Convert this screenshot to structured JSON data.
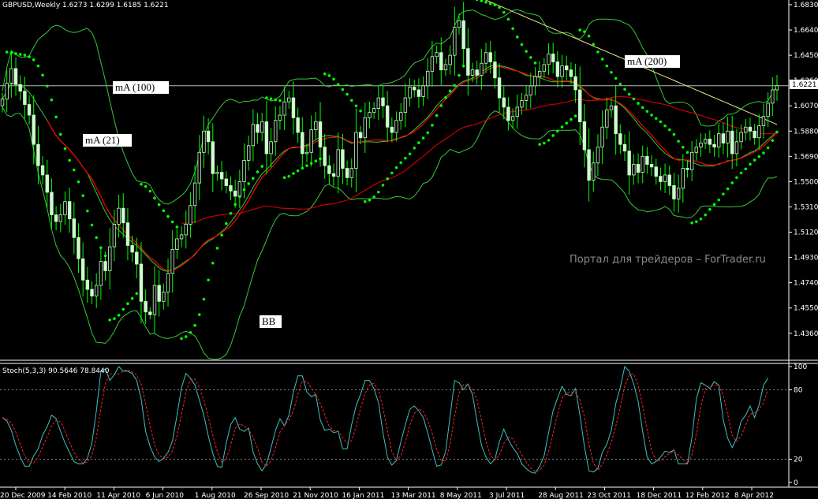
{
  "colors": {
    "background": "#000000",
    "grid": "#ffffff",
    "candle": "#ccffcc",
    "wick": "#00ff00",
    "sar": "#00ff00",
    "ma21": "#ff0000",
    "ma100": "#c80000",
    "ma200": "#f0e68c",
    "bands": "#37c837",
    "stoch_main": "#40c0c0",
    "stoch_signal": "#ff2020",
    "axis_text": "#ffffff"
  },
  "price_pane": {
    "header": "GBPUSD,Weekly  1.6273 1.6299 1.6185 1.6221",
    "y_ticks": [
      "1.6830",
      "1.6640",
      "1.6450",
      "1.6260",
      "1.6070",
      "1.5880",
      "1.5690",
      "1.5500",
      "1.5310",
      "1.5120",
      "1.4930",
      "1.4740",
      "1.4550",
      "1.4360"
    ],
    "current_price_label": "1.6221",
    "annotations": {
      "ma100": "mA (100)",
      "ma21": "mA (21)",
      "ma200": "mA (200)",
      "bb": "BB"
    },
    "watermark": "Портал для трейдеров – ForTrader.ru"
  },
  "stoch_pane": {
    "header": "Stoch(5,3,3) 90.5646 78.8440",
    "y_ticks": [
      "100",
      "80",
      "20",
      "0"
    ]
  },
  "x_ticks": [
    "20 Dec 2009",
    "14 Feb 2010",
    "11 Apr 2010",
    "6 Jun 2010",
    "1 Aug 2010",
    "26 Sep 2010",
    "21 Nov 2010",
    "16 Jan 2011",
    "13 Mar 2011",
    "8 May 2011",
    "3 Jul 2011",
    "28 Aug 2011",
    "23 Oct 2011",
    "18 Dec 2011",
    "12 Feb 2012",
    "8 Apr 2012"
  ],
  "chart_data": {
    "type": "candlestick",
    "symbol": "GBPUSD",
    "timeframe": "Weekly",
    "last_ohlc": {
      "open": 1.6273,
      "high": 1.6299,
      "low": 1.6185,
      "close": 1.6221
    },
    "ylim": [
      1.424,
      1.683
    ],
    "weekly_close": [
      1.612,
      1.624,
      1.635,
      1.623,
      1.618,
      1.608,
      1.6,
      1.578,
      1.562,
      1.555,
      1.542,
      1.525,
      1.52,
      1.525,
      1.535,
      1.522,
      1.508,
      1.492,
      1.476,
      1.469,
      1.464,
      1.472,
      1.49,
      1.483,
      1.501,
      1.518,
      1.53,
      1.519,
      1.502,
      1.497,
      1.488,
      1.46,
      1.452,
      1.45,
      1.472,
      1.46,
      1.467,
      1.481,
      1.499,
      1.507,
      1.51,
      1.518,
      1.532,
      1.549,
      1.572,
      1.588,
      1.58,
      1.556,
      1.557,
      1.552,
      1.547,
      1.543,
      1.539,
      1.55,
      1.566,
      1.577,
      1.593,
      1.587,
      1.595,
      1.571,
      1.58,
      1.596,
      1.6,
      1.61,
      1.613,
      1.598,
      1.587,
      1.571,
      1.572,
      1.589,
      1.595,
      1.576,
      1.562,
      1.556,
      1.554,
      1.574,
      1.56,
      1.553,
      1.56,
      1.587,
      1.583,
      1.598,
      1.602,
      1.605,
      1.613,
      1.607,
      1.591,
      1.587,
      1.596,
      1.602,
      1.613,
      1.621,
      1.619,
      1.614,
      1.622,
      1.633,
      1.644,
      1.647,
      1.634,
      1.638,
      1.645,
      1.666,
      1.671,
      1.65,
      1.63,
      1.634,
      1.63,
      1.639,
      1.647,
      1.64,
      1.628,
      1.613,
      1.606,
      1.596,
      1.599,
      1.606,
      1.611,
      1.615,
      1.622,
      1.629,
      1.633,
      1.638,
      1.646,
      1.64,
      1.629,
      1.637,
      1.634,
      1.629,
      1.619,
      1.595,
      1.574,
      1.551,
      1.564,
      1.576,
      1.591,
      1.604,
      1.607,
      1.586,
      1.578,
      1.573,
      1.555,
      1.563,
      1.557,
      1.569,
      1.563,
      1.561,
      1.554,
      1.55,
      1.555,
      1.547,
      1.537,
      1.545,
      1.56,
      1.559,
      1.572,
      1.576,
      1.579,
      1.582,
      1.578,
      1.576,
      1.586,
      1.579,
      1.588,
      1.571,
      1.58,
      1.587,
      1.591,
      1.588,
      1.583,
      1.592,
      1.599,
      1.609,
      1.619,
      1.6221
    ],
    "stoch_k": [
      56,
      53,
      45,
      32,
      22,
      14,
      14,
      23,
      29,
      41,
      48,
      58,
      55,
      44,
      34,
      26,
      18,
      16,
      16,
      21,
      34,
      62,
      96,
      98,
      88,
      93,
      100,
      96,
      96,
      94,
      88,
      72,
      44,
      31,
      22,
      18,
      21,
      26,
      36,
      58,
      82,
      94,
      90,
      84,
      71,
      58,
      40,
      25,
      14,
      13,
      34,
      50,
      56,
      46,
      44,
      47,
      26,
      16,
      10,
      16,
      30,
      45,
      55,
      49,
      58,
      78,
      92,
      92,
      78,
      74,
      76,
      54,
      45,
      46,
      43,
      44,
      29,
      29,
      50,
      66,
      76,
      88,
      88,
      81,
      69,
      43,
      22,
      15,
      19,
      35,
      50,
      63,
      66,
      62,
      56,
      43,
      28,
      14,
      15,
      27,
      57,
      88,
      86,
      80,
      85,
      76,
      53,
      32,
      22,
      16,
      20,
      35,
      46,
      37,
      30,
      25,
      16,
      12,
      9,
      8,
      14,
      23,
      43,
      62,
      73,
      83,
      76,
      75,
      81,
      58,
      31,
      10,
      9,
      12,
      26,
      33,
      45,
      68,
      82,
      100,
      96,
      85,
      70,
      44,
      22,
      16,
      18,
      22,
      27,
      26,
      28,
      16,
      16,
      16,
      39,
      72,
      86,
      84,
      81,
      87,
      84,
      54,
      38,
      30,
      38,
      53,
      58,
      66,
      56,
      67,
      84,
      90
    ]
  }
}
